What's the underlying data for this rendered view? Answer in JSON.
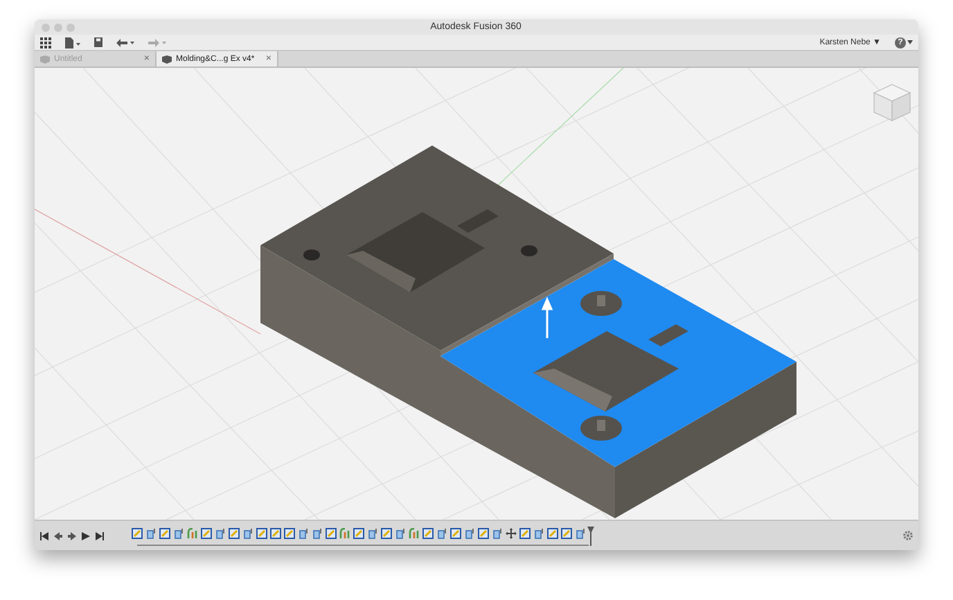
{
  "window": {
    "title": "Autodesk Fusion 360"
  },
  "toolbar": {
    "user": "Karsten Nebe ▼",
    "help": "?"
  },
  "tabs": [
    {
      "label": "Untitled",
      "close": "×",
      "selected": false
    },
    {
      "label": "Molding&C...g Ex v4*",
      "close": "×",
      "selected": true
    }
  ],
  "timeline": {
    "features": [
      {
        "kind": "sketch"
      },
      {
        "kind": "extrude"
      },
      {
        "kind": "sketch"
      },
      {
        "kind": "extrude"
      },
      {
        "kind": "fillet"
      },
      {
        "kind": "sketch"
      },
      {
        "kind": "extrude"
      },
      {
        "kind": "sketch"
      },
      {
        "kind": "extrude"
      },
      {
        "kind": "sketch"
      },
      {
        "kind": "sketch"
      },
      {
        "kind": "sketch"
      },
      {
        "kind": "extrude"
      },
      {
        "kind": "extrude"
      },
      {
        "kind": "sketch"
      },
      {
        "kind": "fillet"
      },
      {
        "kind": "sketch"
      },
      {
        "kind": "extrude"
      },
      {
        "kind": "sketch"
      },
      {
        "kind": "extrude"
      },
      {
        "kind": "fillet"
      },
      {
        "kind": "sketch"
      },
      {
        "kind": "extrude"
      },
      {
        "kind": "sketch"
      },
      {
        "kind": "extrude"
      },
      {
        "kind": "sketch"
      },
      {
        "kind": "extrude"
      },
      {
        "kind": "move"
      },
      {
        "kind": "sketch"
      },
      {
        "kind": "extrude"
      },
      {
        "kind": "sketch"
      },
      {
        "kind": "sketch"
      },
      {
        "kind": "extrude"
      }
    ]
  }
}
